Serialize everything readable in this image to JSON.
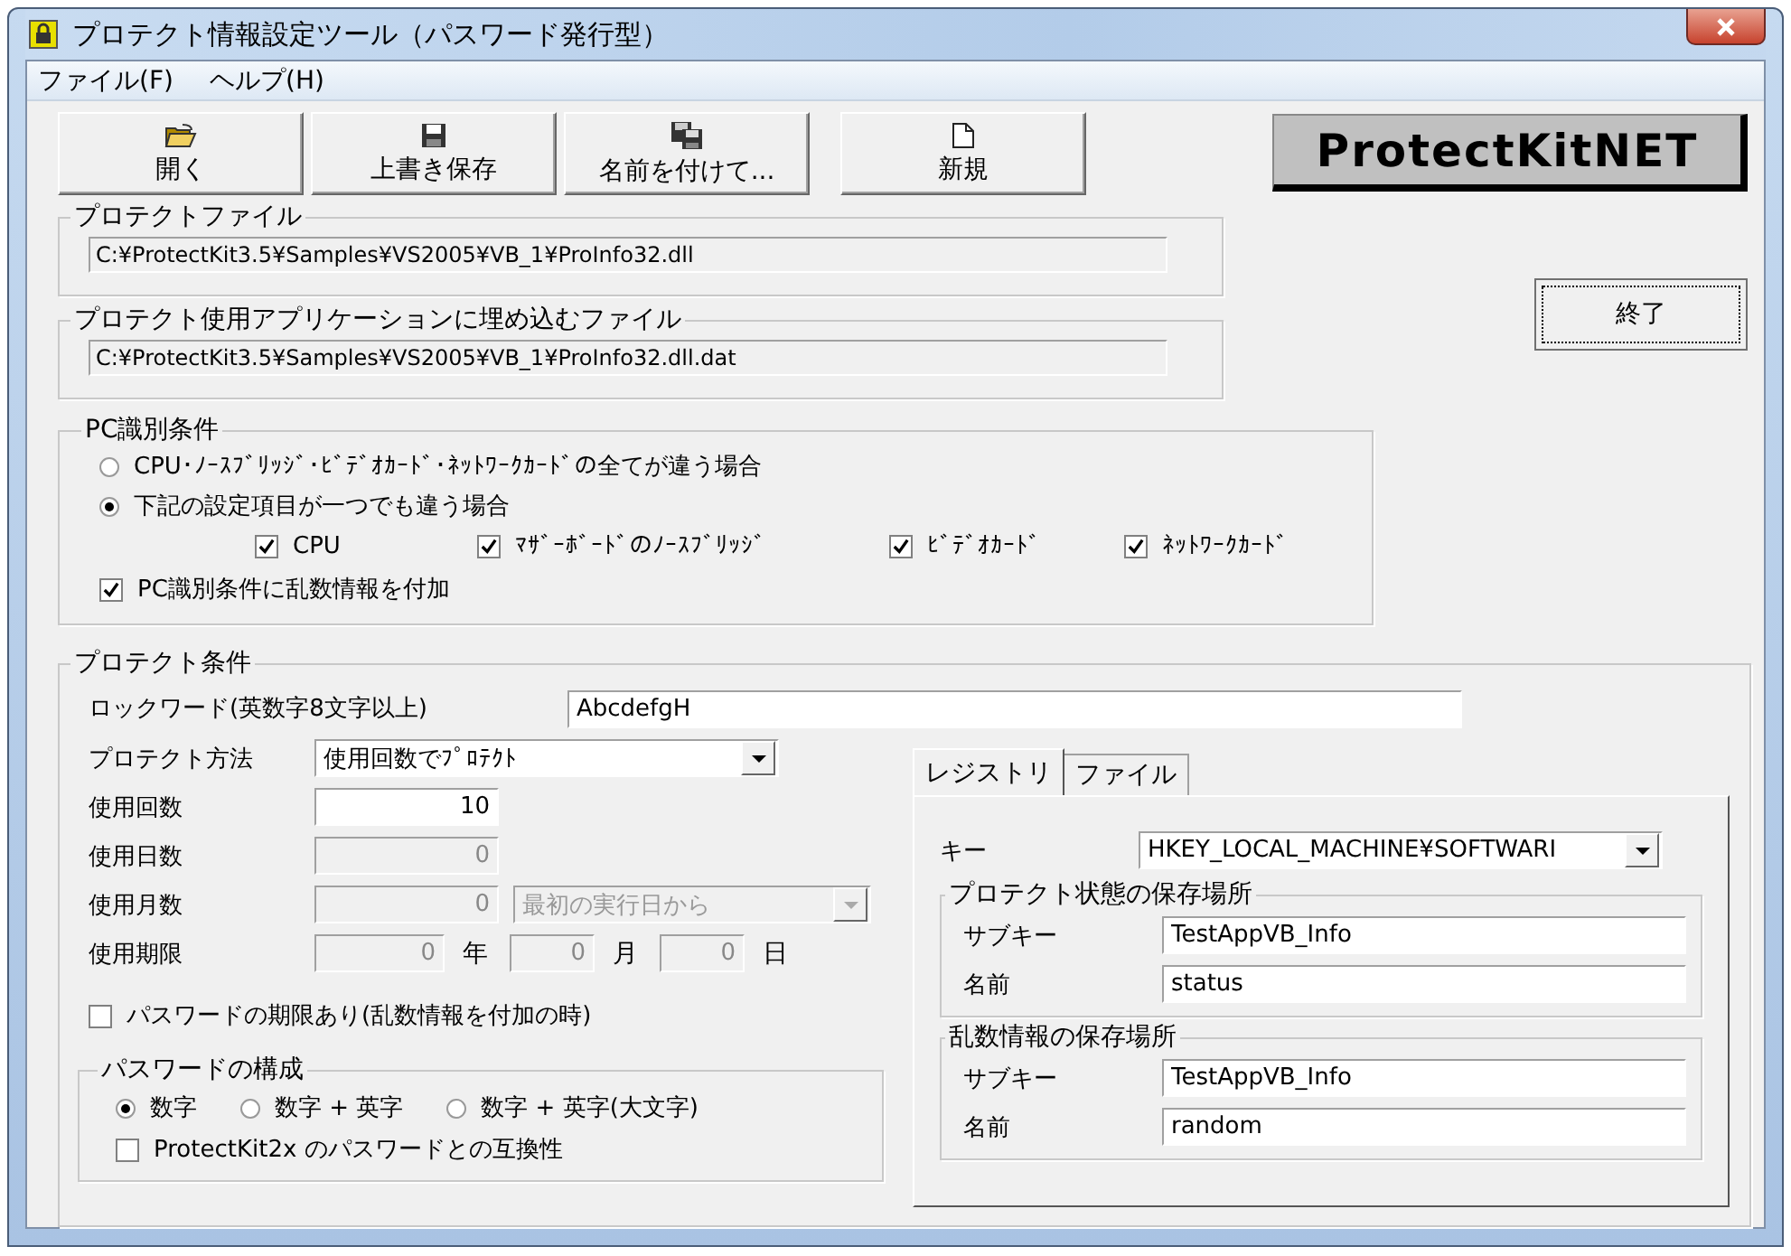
{
  "window": {
    "title": "プロテクト情報設定ツール（パスワード発行型）"
  },
  "menu": [
    {
      "label": "ファイル(F)"
    },
    {
      "label": "ヘルプ(H)"
    }
  ],
  "toolbar": [
    {
      "label": "開く",
      "kind": "open"
    },
    {
      "label": "上書き保存",
      "kind": "save"
    },
    {
      "label": "名前を付けて...",
      "kind": "save_as"
    },
    {
      "label": "新規",
      "kind": "new"
    }
  ],
  "logo": "ProtectKitNET",
  "exit_button": "終了",
  "protect_file": {
    "label": "プロテクトファイル",
    "path": "C:¥ProtectKit3.5¥Samples¥VS2005¥VB_1¥ProInfo32.dll"
  },
  "embed_file": {
    "label": "プロテクト使用アプリケーションに埋め込むファイル",
    "path": "C:¥ProtectKit3.5¥Samples¥VS2005¥VB_1¥ProInfo32.dll.dat"
  },
  "pc_identification": {
    "label": "PC識別条件",
    "options": [
      {
        "label": "CPU･ﾉｰｽﾌﾞﾘｯｼﾞ･ﾋﾞﾃﾞｵｶｰﾄﾞ･ﾈｯﾄﾜｰｸｶｰﾄﾞの全てが違う場合",
        "selected": false
      },
      {
        "label": "下記の設定項目が一つでも違う場合",
        "selected": true
      }
    ],
    "items": [
      {
        "label": "CPU",
        "checked": true
      },
      {
        "label": "ﾏｻﾞｰﾎﾞｰﾄﾞのﾉｰｽﾌﾞﾘｯｼﾞ",
        "checked": true
      },
      {
        "label": "ﾋﾞﾃﾞｵｶｰﾄﾞ",
        "checked": true
      },
      {
        "label": "ﾈｯﾄﾜｰｸｶｰﾄﾞ",
        "checked": true
      }
    ],
    "add_random": {
      "label": "PC識別条件に乱数情報を付加",
      "checked": true
    }
  },
  "protect_conditions": {
    "label": "プロテクト条件",
    "lockword": {
      "label": "ロックワード(英数字8文字以上)",
      "value": "AbcdefgH"
    },
    "method": {
      "label": "プロテクト方法",
      "value": "使用回数でﾌﾟﾛﾃｸﾄ"
    },
    "count": {
      "label": "使用回数",
      "value": "10",
      "disabled": false
    },
    "days": {
      "label": "使用日数",
      "value": "0",
      "disabled": true
    },
    "months": {
      "label": "使用月数",
      "value": "0",
      "disabled": true,
      "start": {
        "value": "最初の実行日から",
        "disabled": true
      }
    },
    "expiry": {
      "label": "使用期限",
      "disabled": true,
      "parts": [
        {
          "value": "0",
          "unit": "年"
        },
        {
          "value": "0",
          "unit": "月"
        },
        {
          "value": "0",
          "unit": "日"
        }
      ]
    },
    "expiry_check": {
      "label": "パスワードの期限あり(乱数情報を付加の時)",
      "checked": false
    },
    "composition": {
      "label": "パスワードの構成",
      "options": [
        {
          "label": "数字",
          "selected": true
        },
        {
          "label": "数字 + 英字",
          "selected": false
        },
        {
          "label": "数字 + 英字(大文字)",
          "selected": false
        }
      ],
      "compat": {
        "label": "ProtectKit2x のパスワードとの互換性",
        "checked": false
      }
    }
  },
  "storage": {
    "tabs": [
      {
        "label": "レジストリ",
        "selected": true
      },
      {
        "label": "ファイル",
        "selected": false
      }
    ],
    "key": {
      "label": "キー",
      "value": "HKEY_LOCAL_MACHINE¥SOFTWARI"
    },
    "groups": [
      {
        "label": "プロテクト状態の保存場所",
        "subkey": {
          "label": "サブキー",
          "value": "TestAppVB_Info"
        },
        "name": {
          "label": "名前",
          "value": "status"
        }
      },
      {
        "label": "乱数情報の保存場所",
        "subkey": {
          "label": "サブキー",
          "value": "TestAppVB_Info"
        },
        "name": {
          "label": "名前",
          "value": "random"
        }
      }
    ]
  }
}
